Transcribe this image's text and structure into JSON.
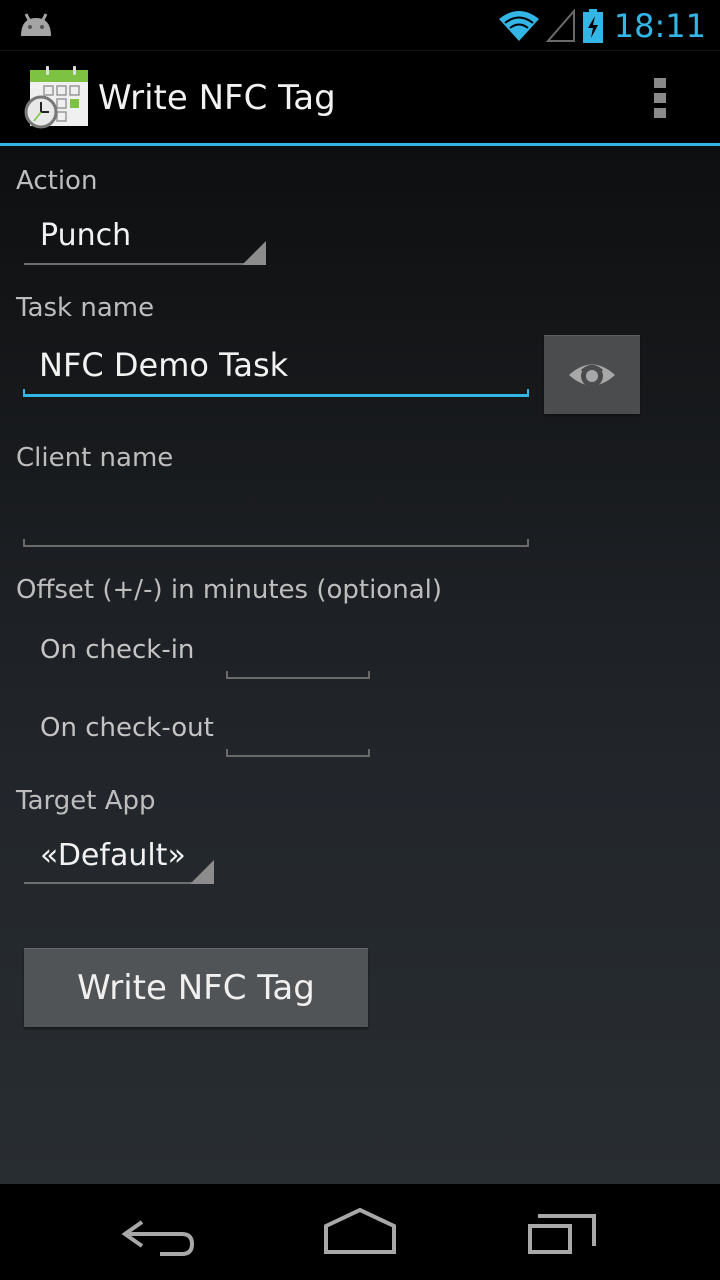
{
  "status_bar": {
    "notification_icon": "android-icon",
    "wifi_icon": "wifi-icon",
    "signal_icon": "cell-signal-icon",
    "battery_icon": "battery-charging-icon",
    "time": "18:11",
    "accent_color": "#33b5e5"
  },
  "action_bar": {
    "app_icon": "calendar-clock-icon",
    "title": "Write NFC Tag",
    "overflow_icon": "overflow-menu-icon"
  },
  "form": {
    "action": {
      "label": "Action",
      "value": "Punch"
    },
    "task_name": {
      "label": "Task name",
      "value": "NFC Demo Task",
      "picker_icon": "eye-icon"
    },
    "client_name": {
      "label": "Client name",
      "value": ""
    },
    "offset": {
      "label": "Offset (+/-) in minutes (optional)",
      "check_in": {
        "label": "On check-in",
        "value": ""
      },
      "check_out": {
        "label": "On check-out",
        "value": ""
      }
    },
    "target_app": {
      "label": "Target App",
      "value": "«Default»"
    },
    "submit_label": "Write NFC Tag"
  },
  "nav_bar": {
    "back_icon": "back-icon",
    "home_icon": "home-icon",
    "recents_icon": "recent-apps-icon"
  }
}
